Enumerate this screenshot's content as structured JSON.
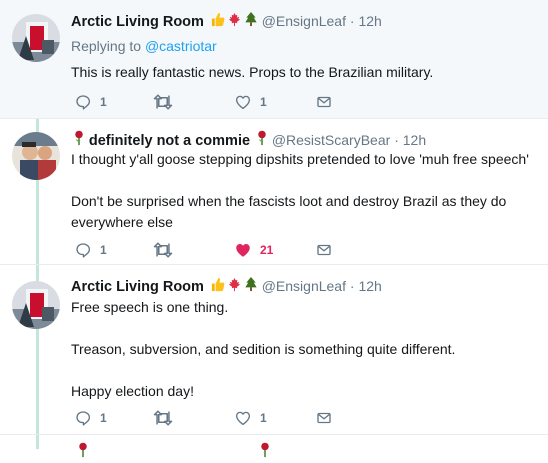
{
  "tweets": [
    {
      "name": "Arctic Living Room",
      "handle": "@EnsignLeaf",
      "separator": "·",
      "time": "12h",
      "replying_label": "Replying to",
      "replying_to": "@castriotar",
      "body": [
        "This is really fantastic news. Props to the Brazilian military."
      ],
      "reply_count": "1",
      "retweet_count": "",
      "like_count": "1",
      "liked": false,
      "badges": [
        "thumbs-up-icon",
        "maple-leaf-icon",
        "evergreen-tree-icon"
      ]
    },
    {
      "name": "definitely not a commie",
      "handle": "@ResistScaryBear",
      "separator": "·",
      "time": "12h",
      "body": [
        "I thought y'all goose stepping dipshits pretended to love 'muh free speech'",
        "Don't be surprised when the fascists loot and destroy Brazil as they do everywhere else"
      ],
      "reply_count": "1",
      "retweet_count": "",
      "like_count": "21",
      "liked": true,
      "badges": [
        "rose-icon",
        "rose-icon"
      ]
    },
    {
      "name": "Arctic Living Room",
      "handle": "@EnsignLeaf",
      "separator": "·",
      "time": "12h",
      "body": [
        "Free speech is one thing.",
        "Treason, subversion, and sedition is something quite different.",
        "Happy election day!"
      ],
      "reply_count": "1",
      "retweet_count": "",
      "like_count": "1",
      "liked": false,
      "badges": [
        "thumbs-up-icon",
        "maple-leaf-icon",
        "evergreen-tree-icon"
      ]
    }
  ],
  "colors": {
    "accent": "#1da1f2",
    "like": "#e0245e",
    "thread_line": "#c4e7dc",
    "muted": "#657786"
  }
}
